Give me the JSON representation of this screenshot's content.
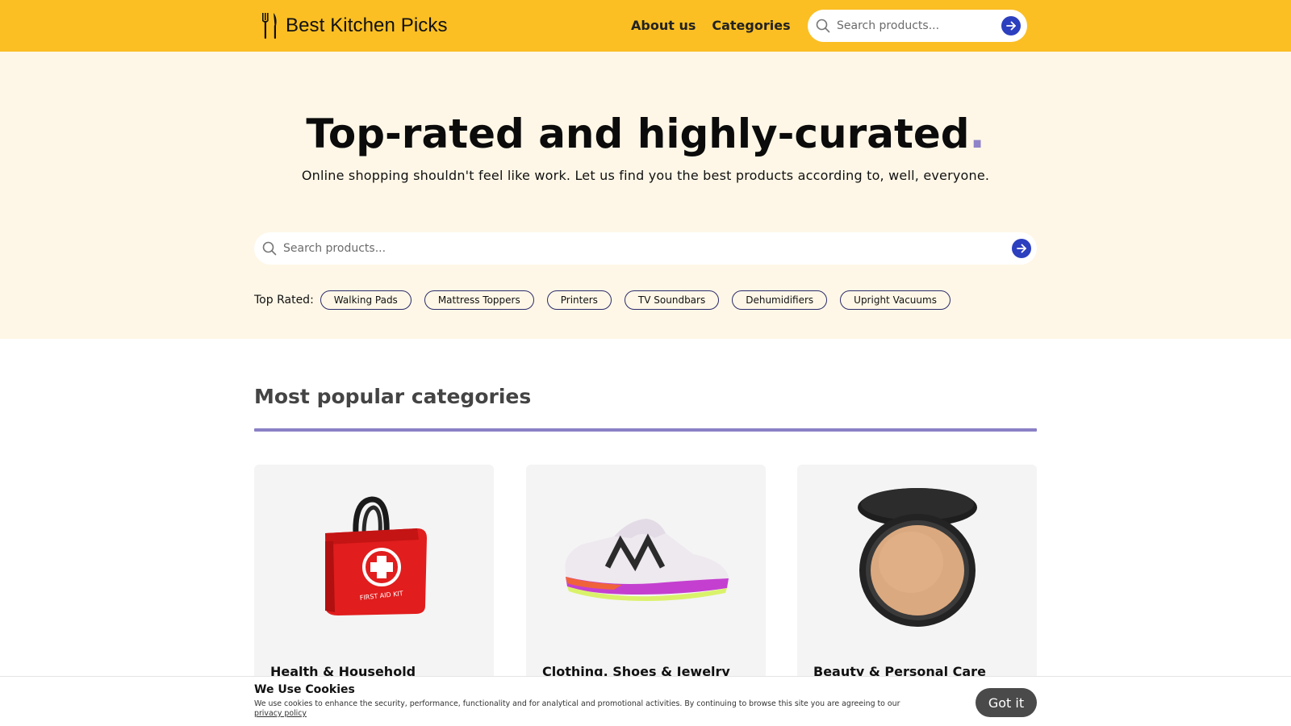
{
  "header": {
    "brand": "Best Kitchen Picks",
    "nav": [
      "About us",
      "Categories"
    ],
    "search_placeholder": "Search products..."
  },
  "hero": {
    "title": "Top-rated and highly-curated",
    "title_dot": ".",
    "subtitle": "Online shopping shouldn't feel like work. Let us find you the best products according to, well, everyone.",
    "search_placeholder": "Search products...",
    "top_rated_label": "Top Rated:",
    "top_rated": [
      "Walking Pads",
      "Mattress Toppers",
      "Printers",
      "TV Soundbars",
      "Dehumidifiers",
      "Upright Vacuums"
    ]
  },
  "popular": {
    "title": "Most popular categories",
    "categories": [
      {
        "name": "Health & Household",
        "image": "first-aid-kit-bag"
      },
      {
        "name": "Clothing, Shoes & Jewelry",
        "image": "running-shoe"
      },
      {
        "name": "Beauty & Personal Care",
        "image": "powder-compact"
      }
    ]
  },
  "cookie": {
    "title": "We Use Cookies",
    "text": "We use cookies to enhance the security, performance, functionality and for analytical and promotional activities. By continuing to browse this site you are agreeing to our",
    "link": "privacy policy",
    "button": "Got it"
  },
  "colors": {
    "header_bg": "#fbbf24",
    "hero_bg": "#fef7e7",
    "accent": "#8f84c9",
    "button": "#2c3fbf"
  }
}
